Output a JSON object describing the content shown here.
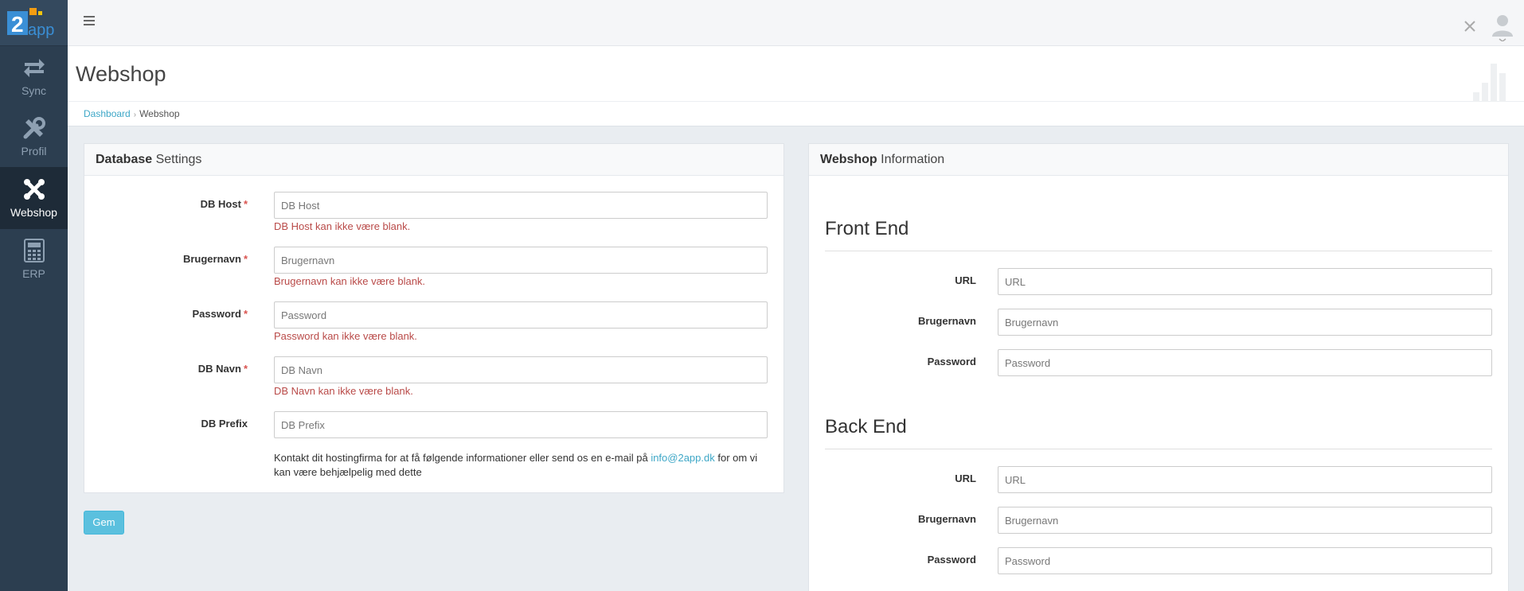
{
  "app": {
    "logo_text": "2app"
  },
  "sidebar": {
    "items": [
      {
        "label": "Sync",
        "icon": "sync-arrows-icon"
      },
      {
        "label": "Profil",
        "icon": "tools-icon"
      },
      {
        "label": "Webshop",
        "icon": "joomla-icon",
        "active": true
      },
      {
        "label": "ERP",
        "icon": "calculator-icon"
      }
    ]
  },
  "header": {
    "title": "Webshop"
  },
  "breadcrumb": {
    "home": "Dashboard",
    "separator": "›",
    "current": "Webshop"
  },
  "db_panel": {
    "title_bold": "Database",
    "title_rest": " Settings",
    "fields": [
      {
        "label": "DB Host",
        "required": "*",
        "placeholder": "DB Host",
        "value": "",
        "error": "DB Host kan ikke være blank."
      },
      {
        "label": "Brugernavn",
        "required": "*",
        "placeholder": "Brugernavn",
        "value": "",
        "error": "Brugernavn kan ikke være blank."
      },
      {
        "label": "Password",
        "required": "*",
        "placeholder": "Password",
        "value": "",
        "error": "Password kan ikke være blank."
      },
      {
        "label": "DB Navn",
        "required": "*",
        "placeholder": "DB Navn",
        "value": "",
        "error": "DB Navn kan ikke være blank."
      },
      {
        "label": "DB Prefix",
        "required": "",
        "placeholder": "DB Prefix",
        "value": "",
        "error": ""
      }
    ],
    "help_before": "Kontakt dit hostingfirma for at få følgende informationer eller send os en e-mail på ",
    "help_link": "info@2app.dk",
    "help_after": " for om vi kan være behjælpelig med dette"
  },
  "save_button": {
    "label": "Gem"
  },
  "webshop_panel": {
    "title_bold": "Webshop",
    "title_rest": " Information",
    "front_end": {
      "title": "Front End",
      "fields": [
        {
          "label": "URL",
          "placeholder": "URL"
        },
        {
          "label": "Brugernavn",
          "placeholder": "Brugernavn"
        },
        {
          "label": "Password",
          "placeholder": "Password"
        }
      ]
    },
    "back_end": {
      "title": "Back End",
      "fields": [
        {
          "label": "URL",
          "placeholder": "URL"
        },
        {
          "label": "Brugernavn",
          "placeholder": "Brugernavn"
        },
        {
          "label": "Password",
          "placeholder": "Password"
        }
      ]
    }
  },
  "colors": {
    "sidebar_bg": "#2c3e50",
    "sidebar_active_bg": "#1e2b38",
    "link": "#3ea7c7",
    "error": "#b94a48",
    "button": "#5bc0de"
  }
}
